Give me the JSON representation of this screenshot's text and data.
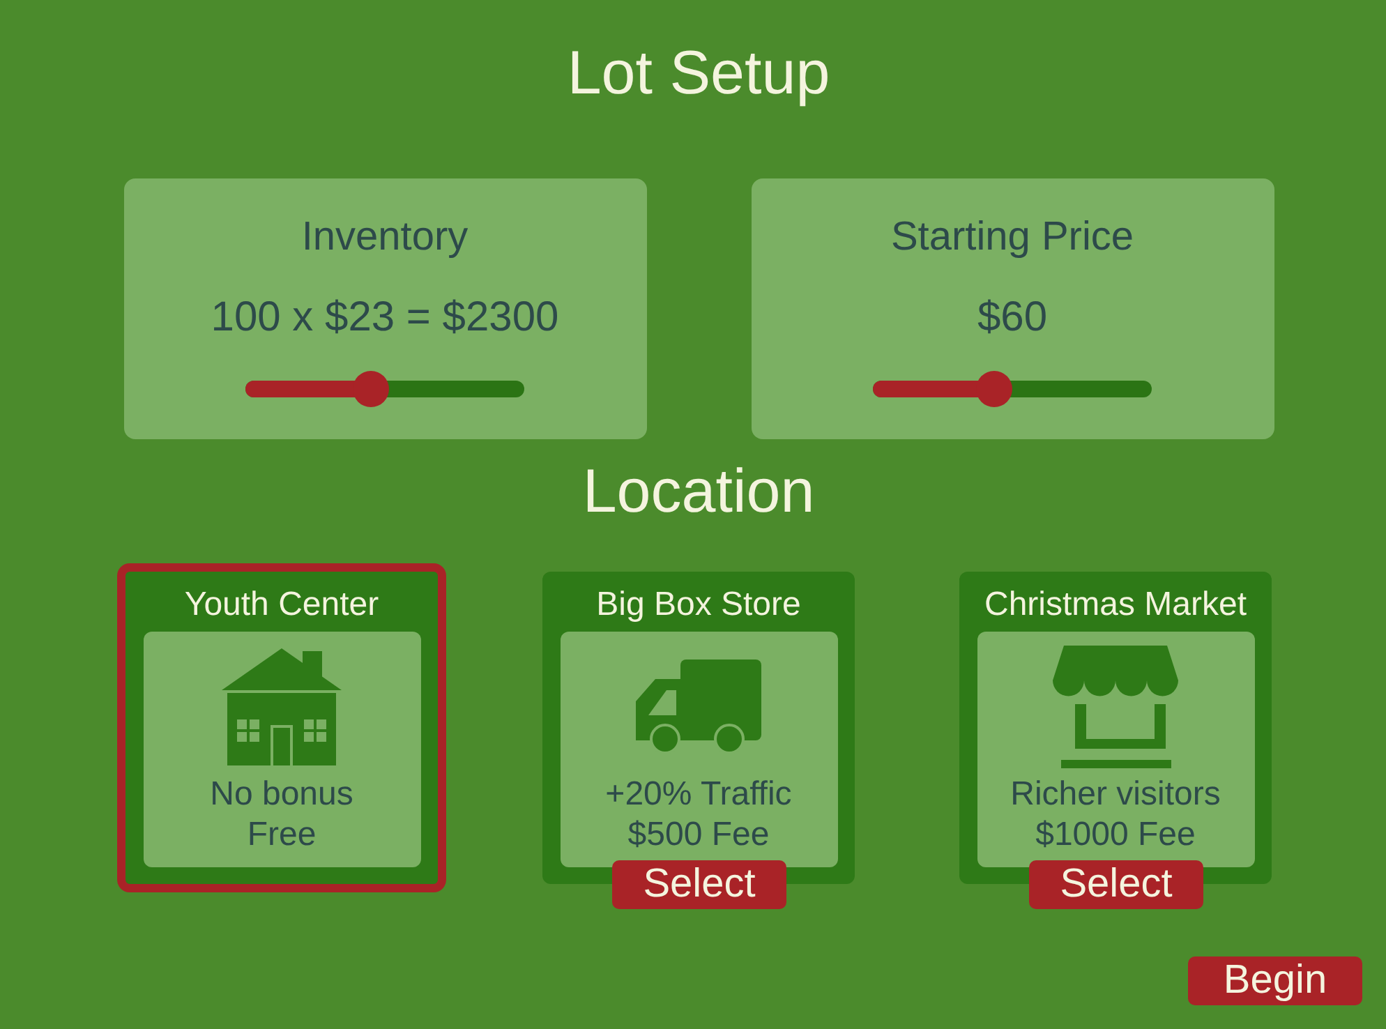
{
  "title": "Lot Setup",
  "settings": [
    {
      "label": "Inventory",
      "value": "100 x $23 = $2300",
      "level": 0.45
    },
    {
      "label": "Starting Price",
      "value": "$60",
      "level": 0.435
    }
  ],
  "location": {
    "title": "Location",
    "options": [
      {
        "name": "Youth Center",
        "bonus": "No bonus",
        "fee": "Free",
        "selected": true
      },
      {
        "name": "Big Box Store",
        "bonus": "+20% Traffic",
        "fee": "$500 Fee",
        "selected": false,
        "button": "Select"
      },
      {
        "name": "Christmas Market",
        "bonus": "Richer visitors",
        "fee": "$1000 Fee",
        "selected": false,
        "button": "Select"
      }
    ]
  },
  "begin_button": "Begin"
}
